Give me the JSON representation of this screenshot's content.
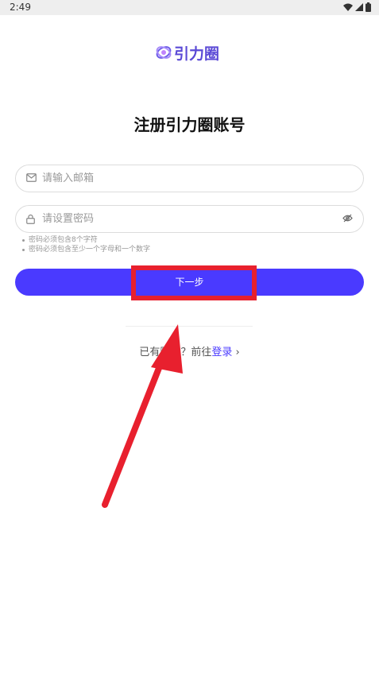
{
  "status_bar": {
    "time": "2:49"
  },
  "logo": {
    "text": "引力圈",
    "brand_color": "#5b4ad6"
  },
  "title": "注册引力圈账号",
  "email_field": {
    "placeholder": "请输入邮箱",
    "value": ""
  },
  "password_field": {
    "placeholder": "请设置密码",
    "value": ""
  },
  "hints": [
    "密码必须包含8个字符",
    "密码必须包含至少一个字母和一个数字"
  ],
  "next_button": {
    "label": "下一步",
    "color": "#4a3aff"
  },
  "login_row": {
    "prefix": "已有账号？前往",
    "link": "登录",
    "suffix": "›"
  },
  "annotation": {
    "highlight_color": "#e8202e"
  }
}
